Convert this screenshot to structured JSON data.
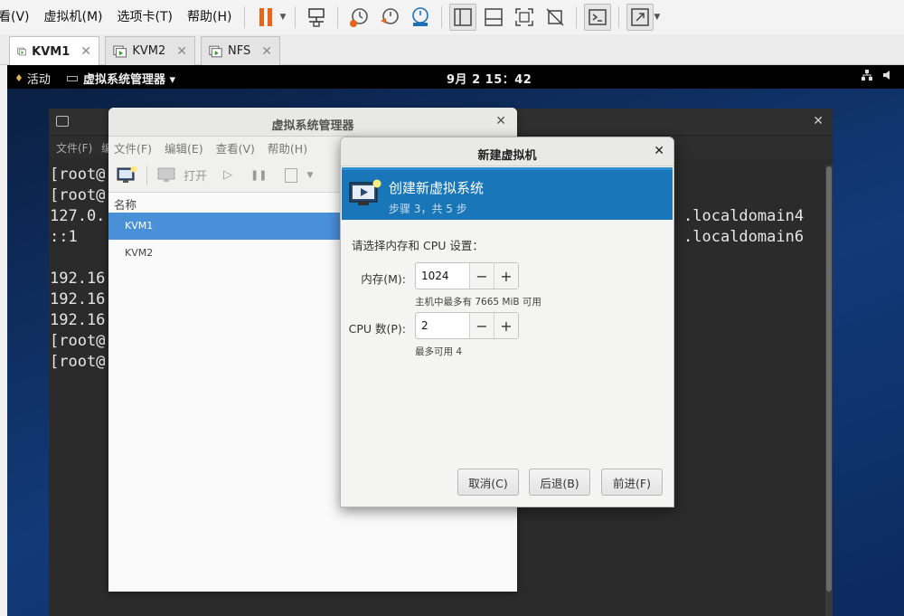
{
  "host_menu": [
    "看(V)",
    "虚拟机(M)",
    "选项卡(T)",
    "帮助(H)"
  ],
  "tabs": [
    {
      "label": "KVM1",
      "active": true
    },
    {
      "label": "KVM2",
      "active": false
    },
    {
      "label": "NFS",
      "active": false
    }
  ],
  "gnome": {
    "activities": "活动",
    "app_menu": "虚拟系统管理器 ▾",
    "clock": "9月 2 15：42"
  },
  "terminal": {
    "menu_first": "文件(F)",
    "menu_cut": "编",
    "lines": [
      "[root@",
      "[root@",
      "127.0.",
      "::1",
      "",
      "192.16",
      "192.16",
      "192.16",
      "[root@",
      "[root@"
    ],
    "right_lines": [
      "localdomain4",
      "localdomain6"
    ]
  },
  "virt_manager": {
    "title": "虚拟系统管理器",
    "menu": [
      "文件(F)",
      "编辑(E)",
      "查看(V)",
      "帮助(H)"
    ],
    "toolbar_open": "打开",
    "list_header": "名称",
    "vms": [
      {
        "name": "KVM1",
        "selected": true
      },
      {
        "name": "KVM2",
        "selected": false
      }
    ]
  },
  "dialog": {
    "title": "新建虚拟机",
    "heading": "创建新虚拟系统",
    "step": "步骤 3，共 5 步",
    "prompt": "请选择内存和 CPU 设置：",
    "memory_label": "内存(M):",
    "memory_value": "1024",
    "memory_hint": "主机中最多有 7665 MiB 可用",
    "cpu_label": "CPU 数(P):",
    "cpu_value": "2",
    "cpu_hint": "最多可用 4",
    "cancel": "取消(C)",
    "back": "后退(B)",
    "forward": "前进(F)"
  },
  "colors": {
    "banner": "#1976b8",
    "selection": "#4a90d9",
    "pause_icon": "#e8641c"
  }
}
